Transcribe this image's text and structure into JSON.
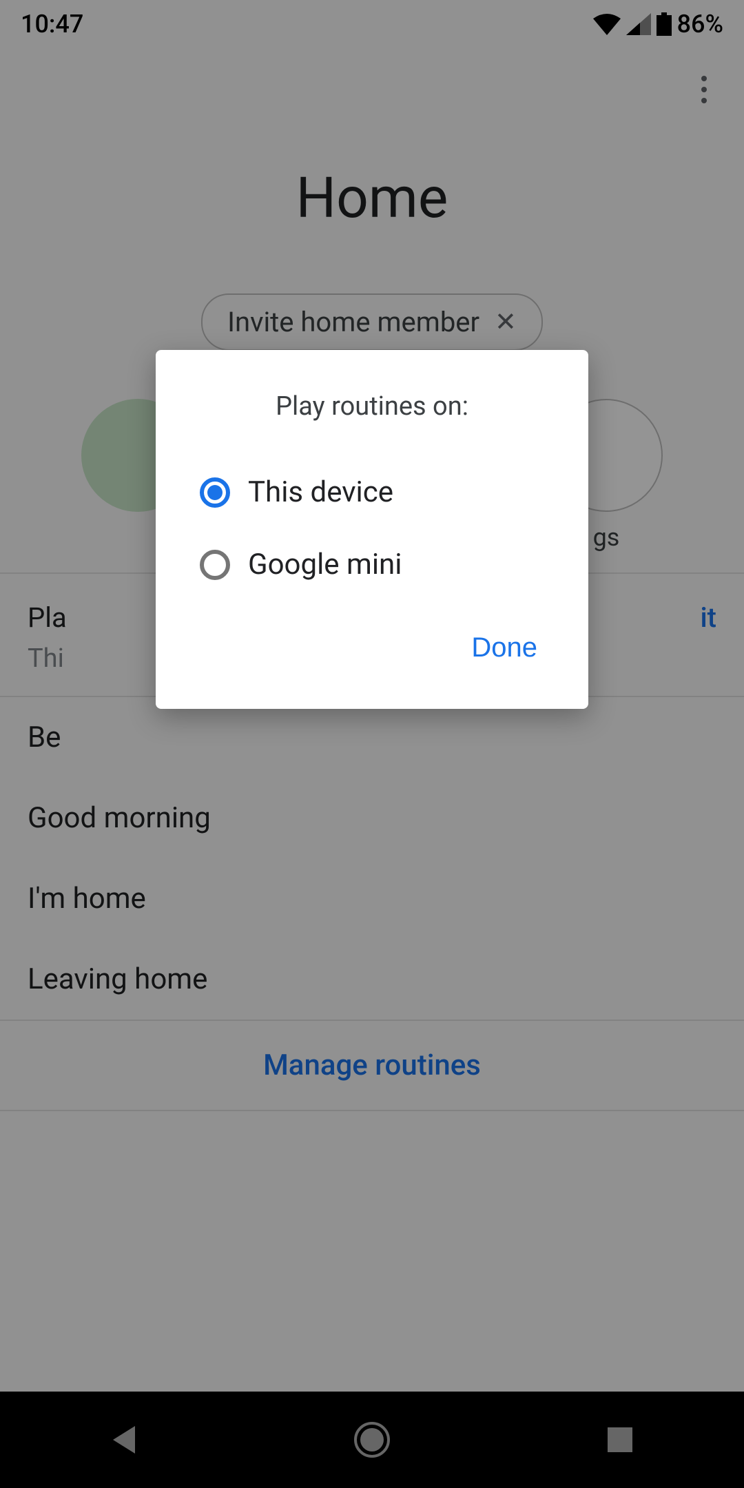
{
  "statusbar": {
    "time": "10:47",
    "battery": "86%"
  },
  "header": {
    "title": "Home"
  },
  "invite_chip": {
    "label": "Invite home member"
  },
  "circles": {
    "last_label": "gs"
  },
  "routines_section": {
    "title_partial": "Pla",
    "subtitle_partial": "Thi",
    "edit_partial": "it",
    "items": [
      "Be",
      "Good morning",
      "I'm home",
      "Leaving home"
    ],
    "manage_link": "Manage routines"
  },
  "dialog": {
    "title": "Play routines on:",
    "options": [
      {
        "label": "This device",
        "selected": true
      },
      {
        "label": "Google mini",
        "selected": false
      }
    ],
    "done": "Done"
  }
}
